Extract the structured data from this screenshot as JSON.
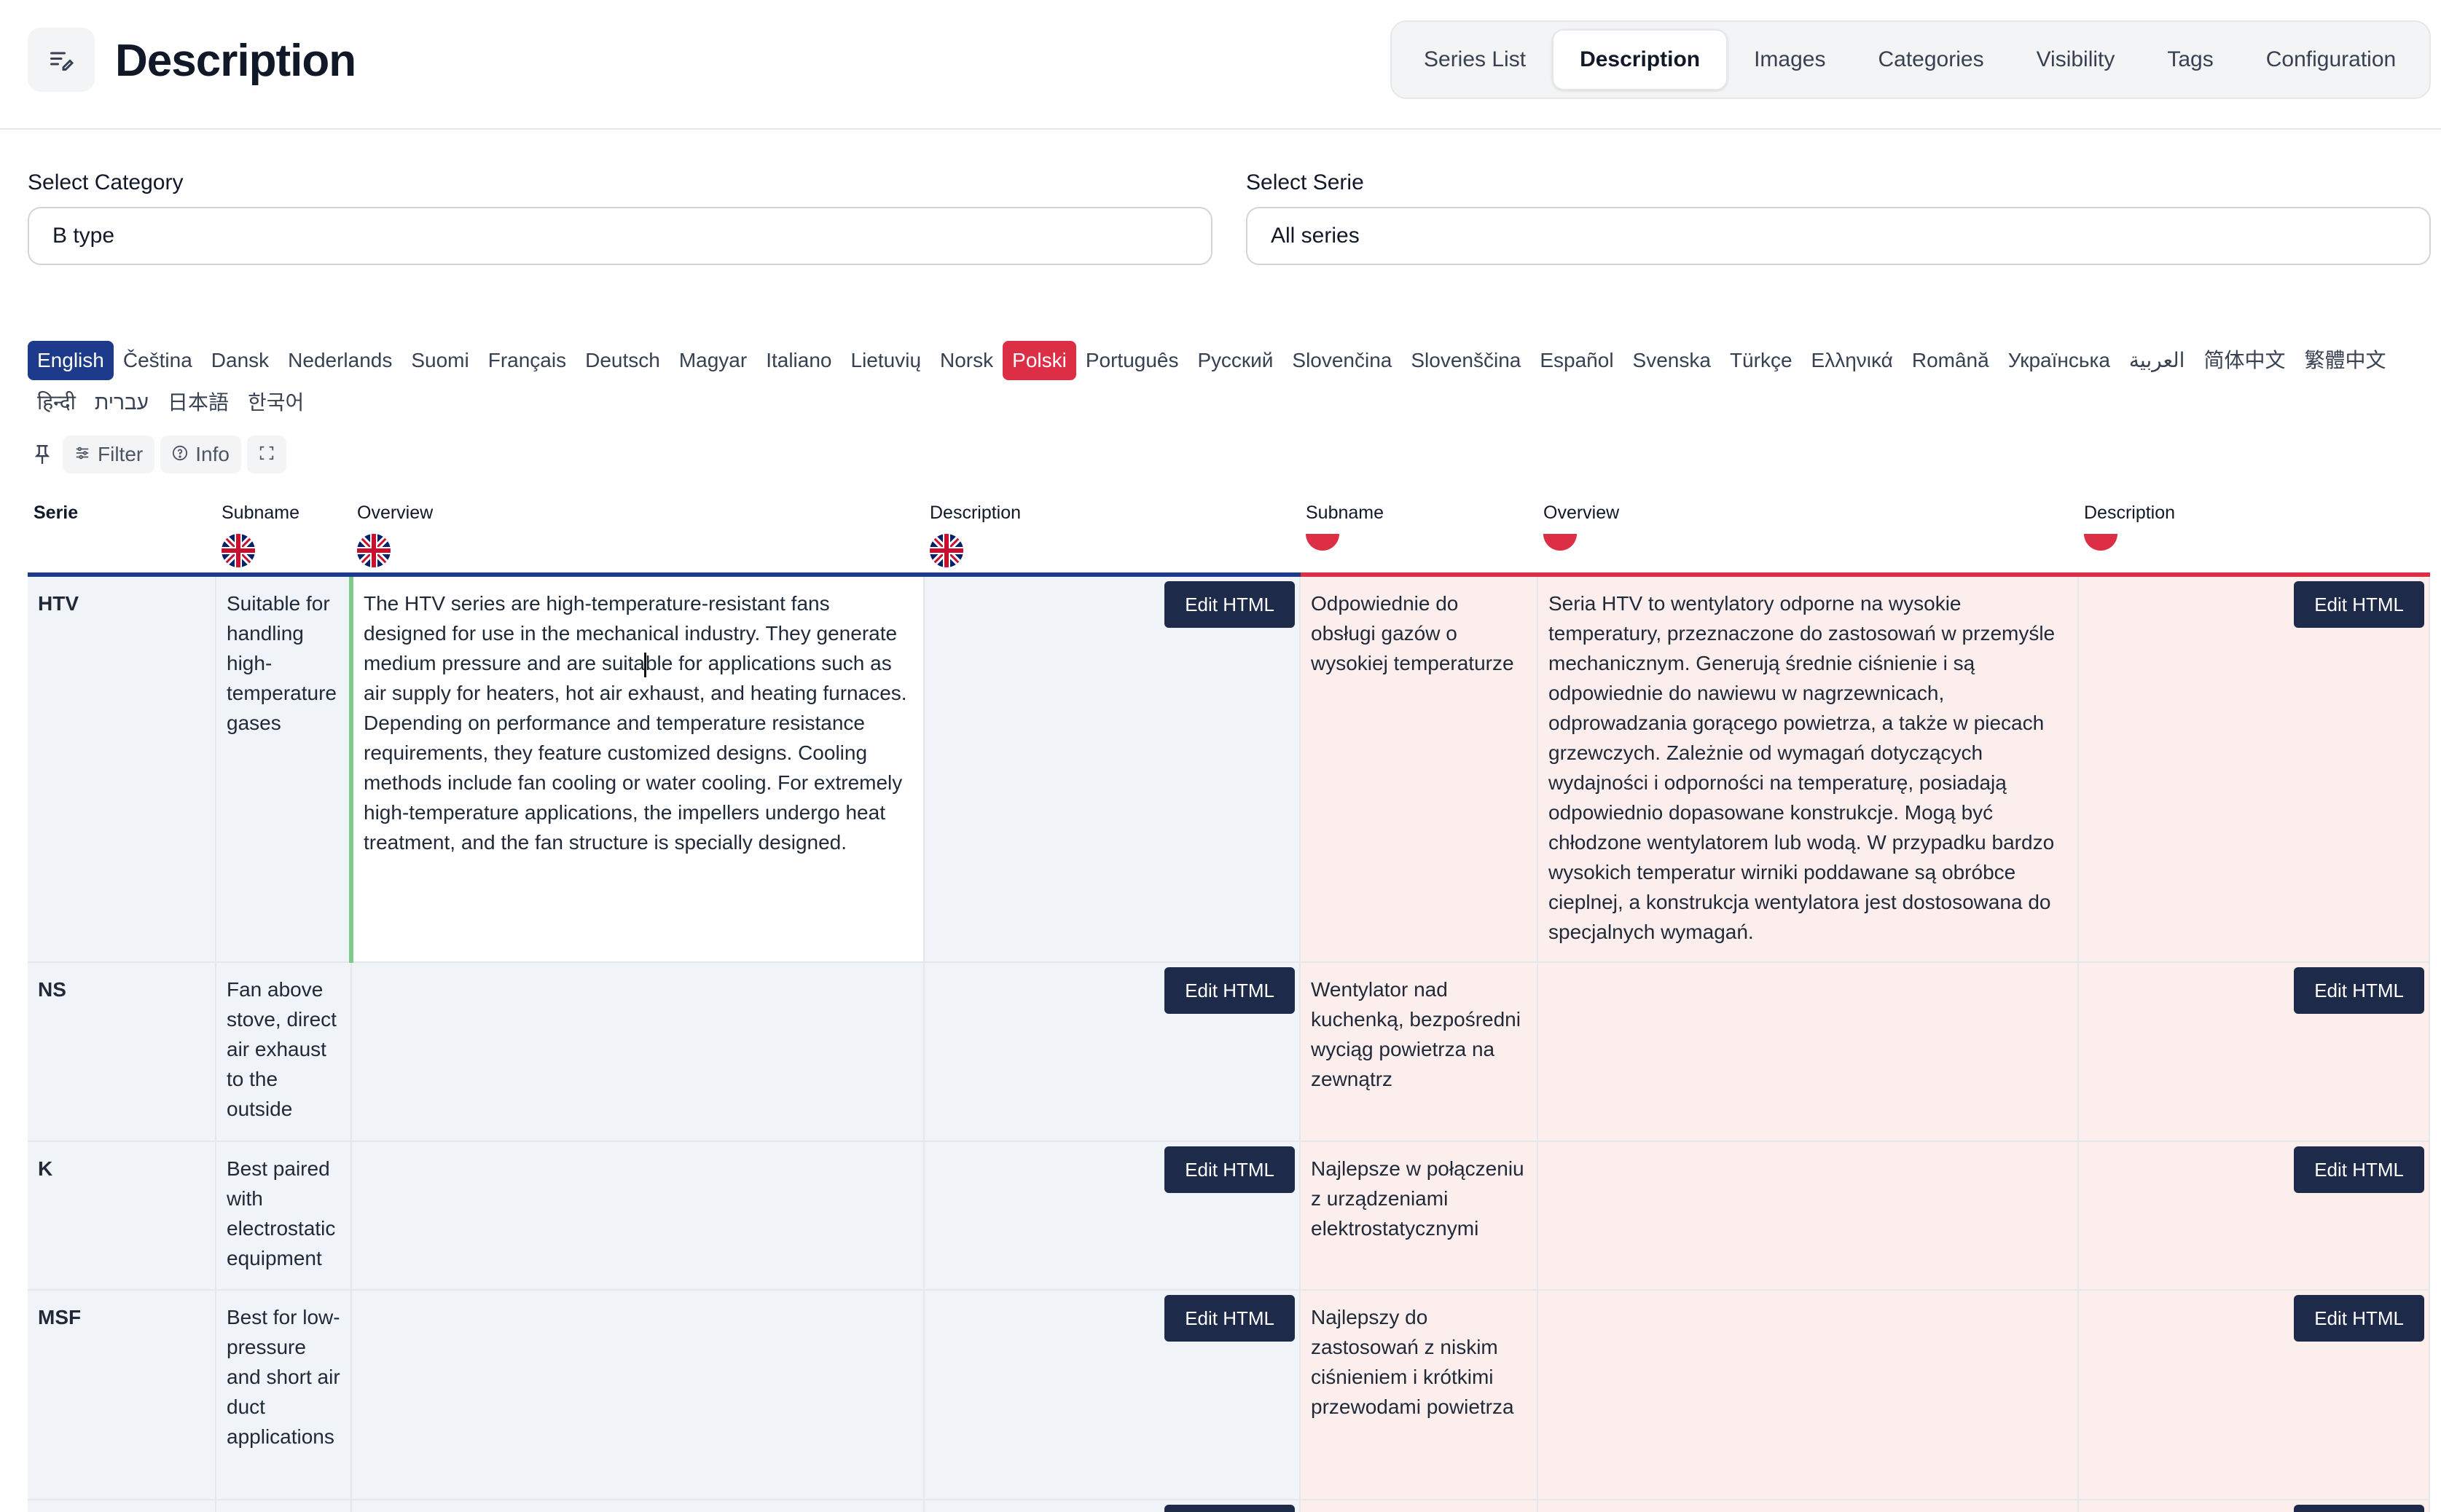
{
  "header": {
    "title": "Description",
    "tabs": [
      "Series List",
      "Description",
      "Images",
      "Categories",
      "Visibility",
      "Tags",
      "Configuration"
    ],
    "active_tab": "Description"
  },
  "filters": {
    "category_label": "Select Category",
    "category_value": "B type",
    "serie_label": "Select Serie",
    "serie_value": "All series"
  },
  "languages": [
    "English",
    "Čeština",
    "Dansk",
    "Nederlands",
    "Suomi",
    "Français",
    "Deutsch",
    "Magyar",
    "Italiano",
    "Lietuvių",
    "Norsk",
    "Polski",
    "Português",
    "Русский",
    "Slovenčina",
    "Slovenščina",
    "Español",
    "Svenska",
    "Türkçe",
    "Ελληνικά",
    "Română",
    "Українська",
    "العربية",
    "简体中文",
    "繁體中文",
    "हिन्दी",
    "עברית",
    "日本語",
    "한국어"
  ],
  "toolbar": {
    "filter_label": "Filter",
    "info_label": "Info"
  },
  "table": {
    "headers": {
      "serie": "Serie",
      "en_subname": "Subname",
      "en_overview": "Overview",
      "en_description": "Description",
      "pl_subname": "Subname",
      "pl_overview": "Overview",
      "pl_description": "Description"
    },
    "edit_label": "Edit HTML",
    "rows": [
      {
        "serie": "HTV",
        "en_subname": "Suitable for handling high-temperature gases",
        "en_overview_before": "The HTV series are high-temperature-resistant fans designed for use in the mechanical industry. They generate medium pressure and are suita",
        "en_overview_after": "ble for applications such as air supply for heaters, hot air exhaust, and heating furnaces. Depending on performance and temperature resistance requirements, they feature customized designs. Cooling methods include fan cooling or water cooling. For extremely high-temperature applications, the impellers undergo heat treatment, and the fan structure is specially designed.",
        "pl_subname": "Odpowiednie do obsługi gazów o wysokiej temperaturze",
        "pl_overview": "Seria HTV to wentylatory odporne na wysokie temperatury, przeznaczone do zastosowań w przemyśle mechanicznym. Generują średnie ciśnienie i są odpowiednie do nawiewu w nagrzewnicach, odprowadzania gorącego powietrza, a także w piecach grzewczych. Zależnie od wymagań dotyczących wydajności i odporności na temperaturę, posiadają odpowiednio dopasowane konstrukcje. Mogą być chłodzone wentylatorem lub wodą. W przypadku bardzo wysokich temperatur wirniki poddawane są obróbce cieplnej, a konstrukcja wentylatora jest dostosowana do specjalnych wymagań."
      },
      {
        "serie": "NS",
        "en_subname": "Fan above stove, direct air exhaust to the outside",
        "pl_subname": "Wentylator nad kuchenką, bezpośredni wyciąg powietrza na zewnątrz"
      },
      {
        "serie": "K",
        "en_subname": "Best paired with electrostatic equipment",
        "pl_subname": "Najlepsze w połączeniu z urządzeniami elektrostatycznymi"
      },
      {
        "serie": "MSF",
        "en_subname": "Best for low-pressure and short air duct applications",
        "pl_subname": "Najlepszy do zastosowań z niskim ciśnieniem i krótkimi przewodami powietrza"
      }
    ]
  },
  "colors": {
    "english_accent": "#1e3a8a",
    "polish_accent": "#dc2f45",
    "edit_button": "#1e2a4a",
    "active_editor_border": "#7ccb8a"
  }
}
